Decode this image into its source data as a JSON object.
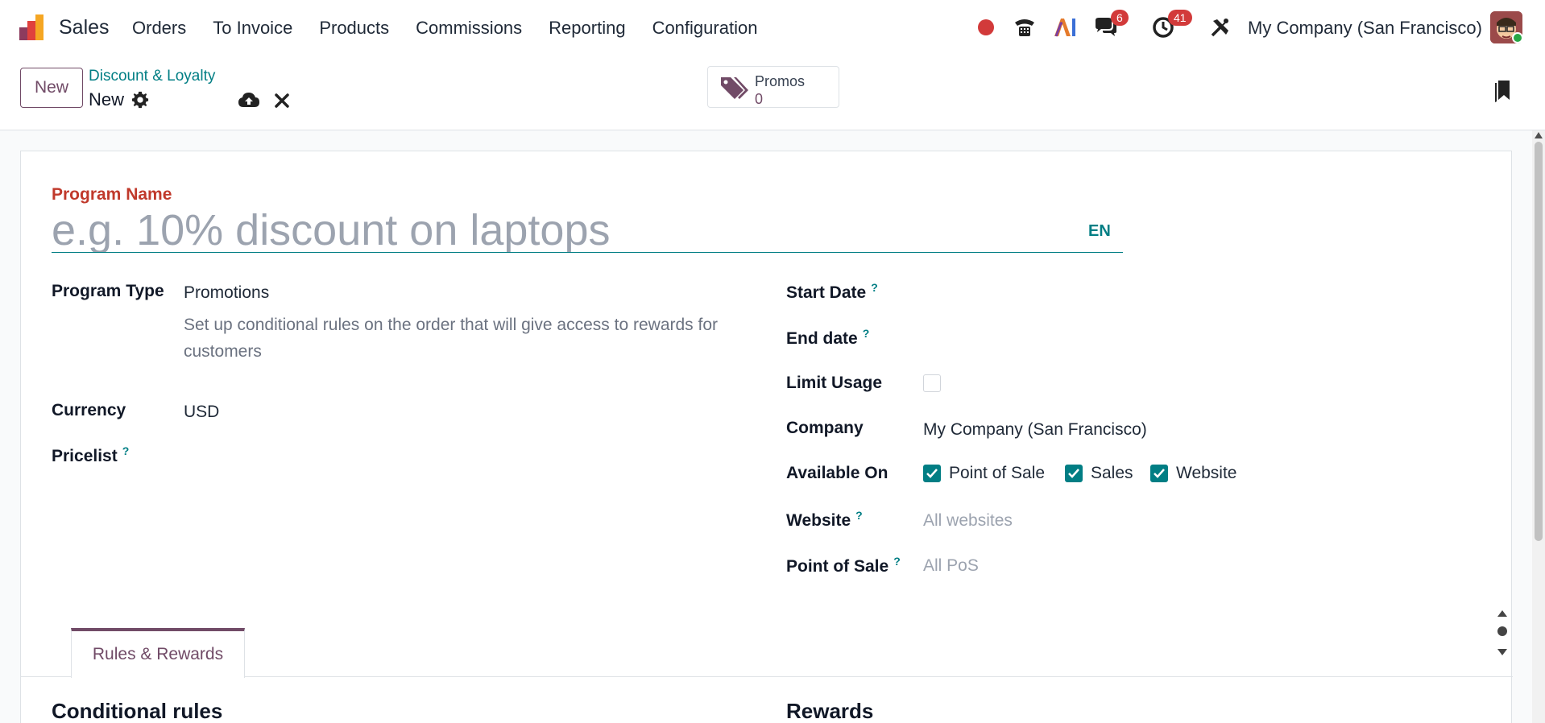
{
  "navbar": {
    "app_name": "Sales",
    "menu": [
      "Orders",
      "To Invoice",
      "Products",
      "Commissions",
      "Reporting",
      "Configuration"
    ],
    "messages_count": "6",
    "activities_count": "41",
    "company": "My Company (San Francisco)"
  },
  "control": {
    "new_button": "New",
    "breadcrumb": "Discount & Loyalty",
    "record_name": "New",
    "smart_button": {
      "label": "Promos",
      "value": "0"
    }
  },
  "form": {
    "program_name_label": "Program Name",
    "program_name_placeholder": "e.g. 10% discount on laptops",
    "lang": "EN",
    "left": {
      "program_type_label": "Program Type",
      "program_type_value": "Promotions",
      "program_type_help": "Set up conditional rules on the order that will give access to rewards for customers",
      "currency_label": "Currency",
      "currency_value": "USD",
      "pricelist_label": "Pricelist"
    },
    "right": {
      "start_date_label": "Start Date",
      "end_date_label": "End date",
      "limit_usage_label": "Limit Usage",
      "company_label": "Company",
      "company_value": "My Company (San Francisco)",
      "available_on_label": "Available On",
      "available_on": [
        "Point of Sale",
        "Sales",
        "Website"
      ],
      "website_label": "Website",
      "website_placeholder": "All websites",
      "pos_label": "Point of Sale",
      "pos_placeholder": "All PoS"
    },
    "help_mark": "?",
    "tab_label": "Rules & Rewards",
    "conditional_rules_title": "Conditional rules",
    "rewards_title": "Rewards"
  },
  "colors": {
    "accent": "#714b67",
    "teal": "#017e84",
    "required": "#c0392b",
    "badge": "#d23a3a"
  }
}
